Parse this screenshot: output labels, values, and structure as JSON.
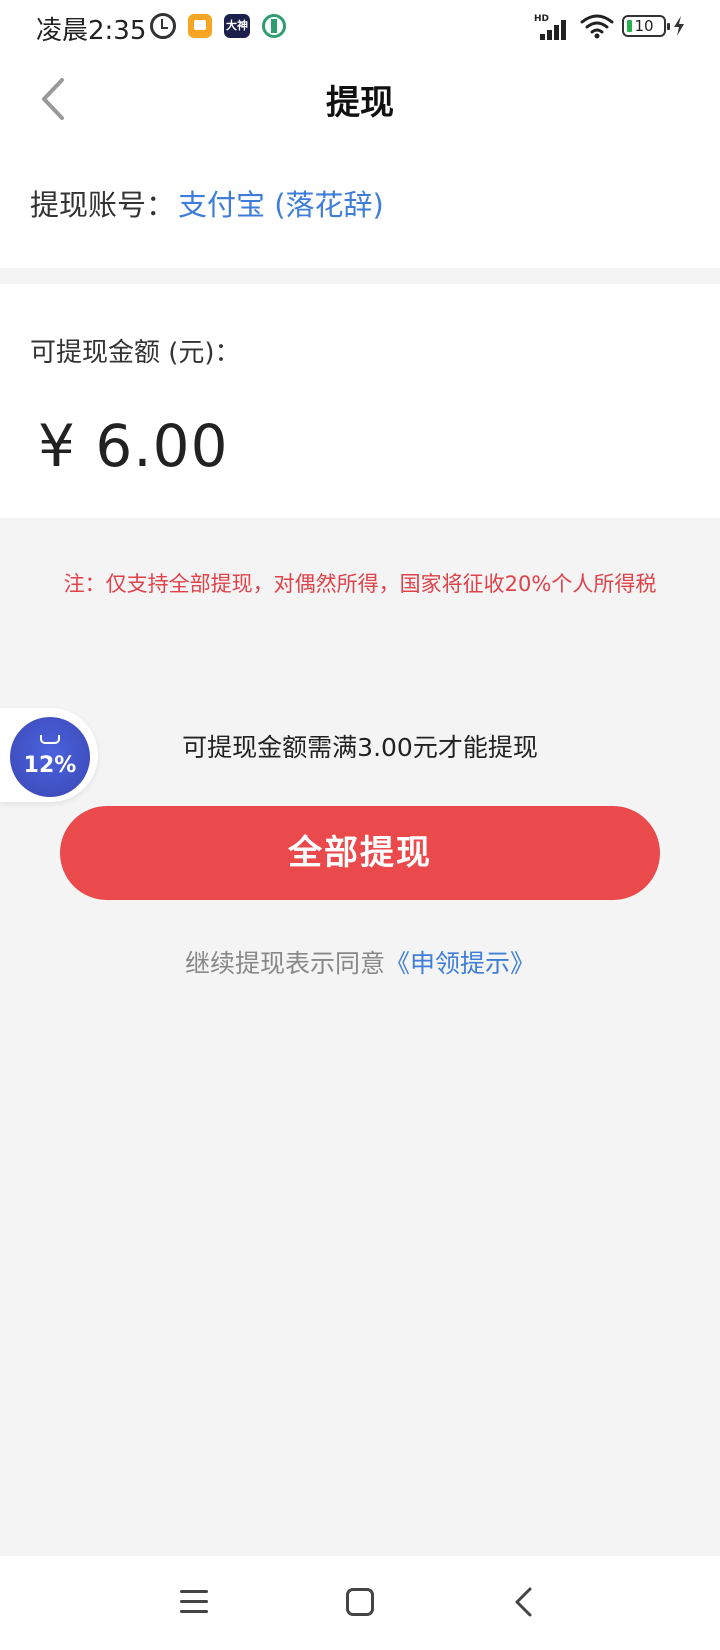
{
  "status_bar": {
    "time": "凌晨2:35",
    "app_icon_2_text": "大神",
    "signal_label": "HD",
    "battery": "10"
  },
  "header": {
    "title": "提现"
  },
  "account": {
    "label": "提现账号：",
    "value": "支付宝 (落花辞)"
  },
  "amount": {
    "label": "可提现金额 (元)：",
    "value": "¥ 6.00"
  },
  "notice": "注：仅支持全部提现，对偶然所得，国家将征收20%个人所得税",
  "floating_badge": {
    "percent": "12%"
  },
  "min_note": "可提现金额需满3.00元才能提现",
  "withdraw_button": "全部提现",
  "agreement": {
    "text": "继续提现表示同意",
    "link": "《申领提示》"
  },
  "colors": {
    "accent_red": "#ea4a4c",
    "link_blue": "#3f7ed8",
    "notice_red": "#e0424a",
    "badge_blue": "#4b63df"
  },
  "icons": [
    "alarm-icon",
    "app-icon",
    "wifi-icon",
    "signal-icon",
    "battery-icon",
    "charging-icon",
    "back-arrow-icon",
    "menu-icon",
    "home-icon",
    "system-back-icon"
  ]
}
